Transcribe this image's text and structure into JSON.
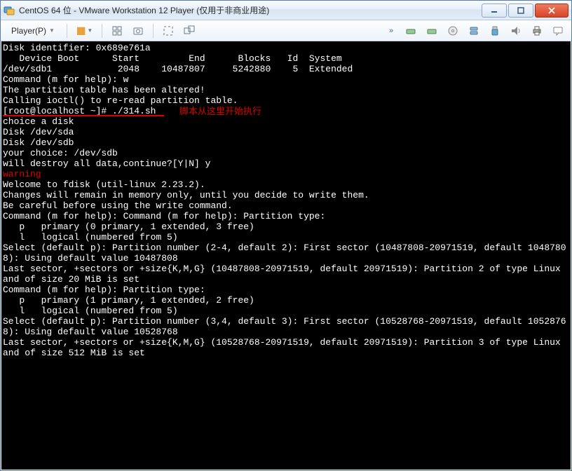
{
  "window": {
    "title": "CentOS 64 位 - VMware Workstation 12 Player (仅用于非商业用途)"
  },
  "toolbar": {
    "player_label": "Player(P)"
  },
  "annotation": {
    "text": "脚本从这里开始执行"
  },
  "terminal": {
    "lines": [
      "Disk identifier: 0x689e761a",
      "",
      "   Device Boot      Start         End      Blocks   Id  System",
      "/dev/sdb1            2048    10487807     5242880    5  Extended",
      "",
      "Command (m for help): w",
      "The partition table has been altered!",
      "",
      "Calling ioctl() to re-read partition table.",
      "[root@localhost ~]# ./314.sh",
      "choice a disk",
      "Disk /dev/sda",
      "Disk /dev/sdb",
      "your choice: /dev/sdb",
      "will destroy all data,continue?[Y|N] y",
      "warning",
      "Welcome to fdisk (util-linux 2.23.2).",
      "",
      "Changes will remain in memory only, until you decide to write them.",
      "Be careful before using the write command.",
      "",
      "",
      "Command (m for help): Command (m for help): Partition type:",
      "   p   primary (0 primary, 1 extended, 3 free)",
      "   l   logical (numbered from 5)",
      "Select (default p): Partition number (2-4, default 2): First sector (10487808-20971519, default 10487808): Using default value 10487808",
      "Last sector, +sectors or +size{K,M,G} (10487808-20971519, default 20971519): Partition 2 of type Linux and of size 20 MiB is set",
      "",
      "Command (m for help): Partition type:",
      "   p   primary (1 primary, 1 extended, 2 free)",
      "   l   logical (numbered from 5)",
      "Select (default p): Partition number (3,4, default 3): First sector (10528768-20971519, default 10528768): Using default value 10528768",
      "Last sector, +sectors or +size{K,M,G} (10528768-20971519, default 20971519): Partition 3 of type Linux and of size 512 MiB is set"
    ],
    "prompt_index": 9,
    "warning_index": 15
  }
}
